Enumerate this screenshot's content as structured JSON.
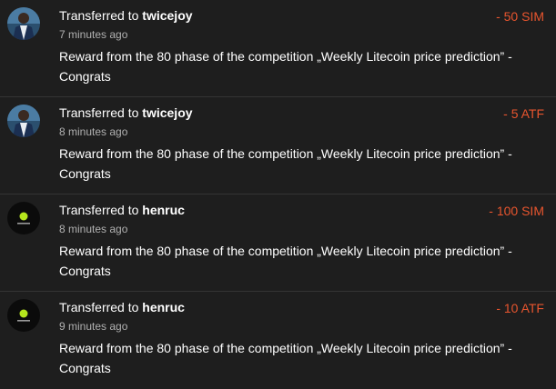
{
  "colors": {
    "background": "#1e1e1e",
    "divider": "#343434",
    "amount_negative": "#e8552e",
    "muted_text": "#b0b0b0",
    "text": "#ffffff"
  },
  "transactions": [
    {
      "prefix": "Transferred to ",
      "recipient": "twicejoy",
      "time": "7 minutes ago",
      "description": "Reward from the 80 phase of the competition „Weekly Litecoin price prediction” - Congrats",
      "amount": "- 50 SIM",
      "avatar": "person-photo-avatar"
    },
    {
      "prefix": "Transferred to ",
      "recipient": "twicejoy",
      "time": "8 minutes ago",
      "description": "Reward from the 80 phase of the competition „Weekly Litecoin price prediction” - Congrats",
      "amount": "- 5 ATF",
      "avatar": "person-photo-avatar"
    },
    {
      "prefix": "Transferred to ",
      "recipient": "henruc",
      "time": "8 minutes ago",
      "description": "Reward from the 80 phase of the competition „Weekly Litecoin price prediction” - Congrats",
      "amount": "- 100 SIM",
      "avatar": "green-logo-avatar"
    },
    {
      "prefix": "Transferred to ",
      "recipient": "henruc",
      "time": "9 minutes ago",
      "description": "Reward from the 80 phase of the competition „Weekly Litecoin price prediction” - Congrats",
      "amount": "- 10 ATF",
      "avatar": "green-logo-avatar"
    }
  ]
}
